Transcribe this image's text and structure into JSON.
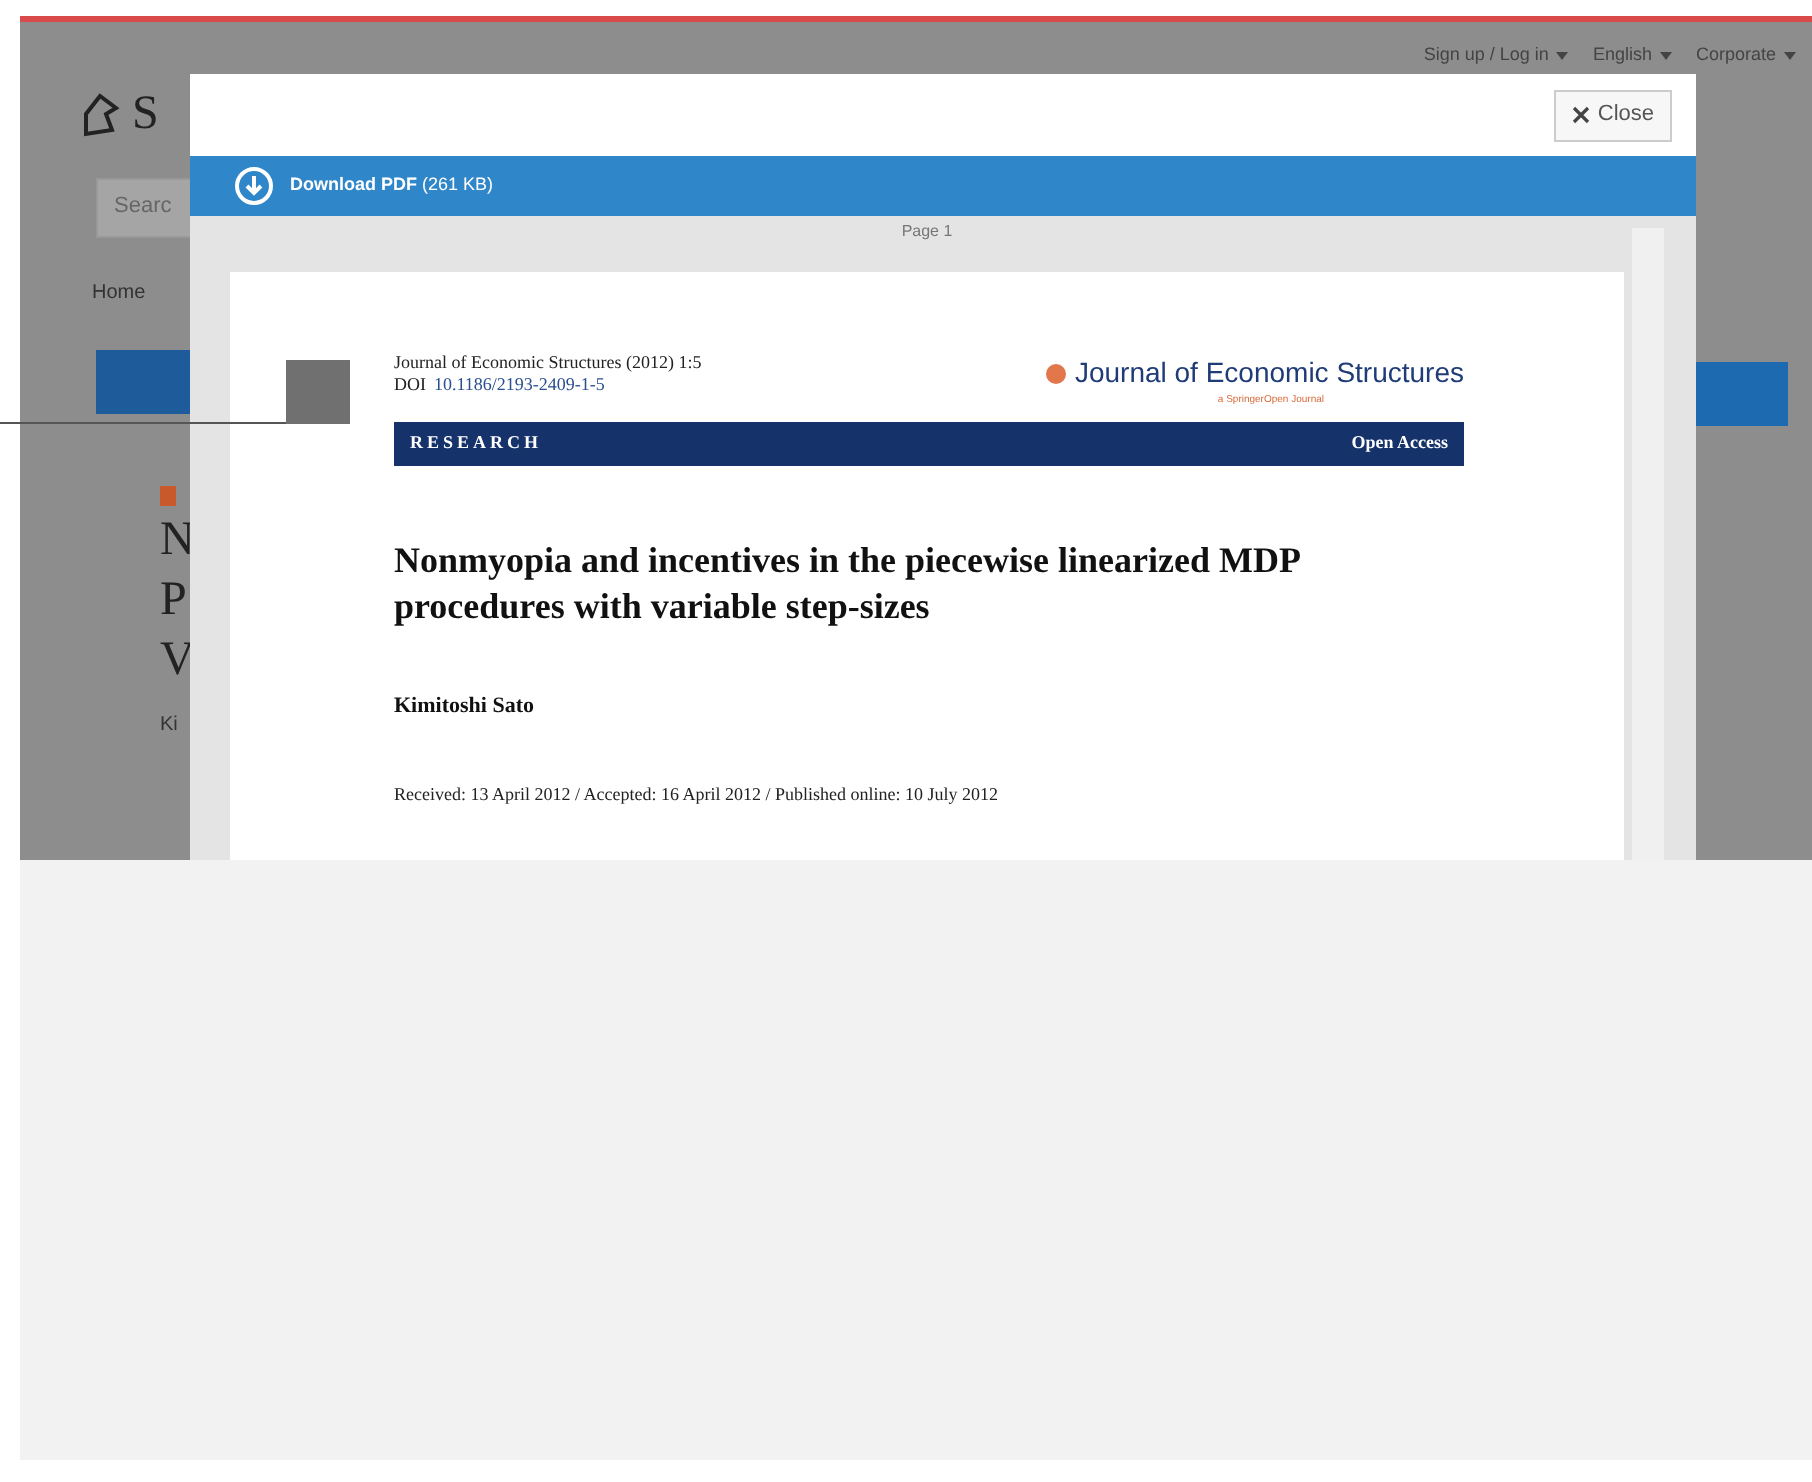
{
  "top_links": [
    {
      "label": "Sign up / Log in"
    },
    {
      "label": "English"
    },
    {
      "label": "Corporate"
    }
  ],
  "logo": {
    "text": "S"
  },
  "search": {
    "placeholder": "Searc"
  },
  "nav": {
    "label": "Home"
  },
  "article_fragments": [
    "N",
    "P",
    "V"
  ],
  "author_fragment": "Ki",
  "modal": {
    "close_label": "Close",
    "download": {
      "label": "Download PDF",
      "size": "(261 KB)"
    },
    "page_label": "Page 1",
    "pdf": {
      "citation": "Journal of Economic Structures (2012) 1:5",
      "doi_label": "DOI",
      "doi": "10.1186/2193-2409-1-5",
      "journal": "Journal of Economic Structures",
      "journal_sub": "a SpringerOpen Journal",
      "section": "RESEARCH",
      "access": "Open Access",
      "title": "Nonmyopia and incentives in the piecewise linearized MDP procedures with variable step-sizes",
      "author": "Kimitoshi Sato",
      "dates": "Received: 13 April 2012 / Accepted: 16 April 2012 / Published online: 10 July 2012"
    }
  }
}
